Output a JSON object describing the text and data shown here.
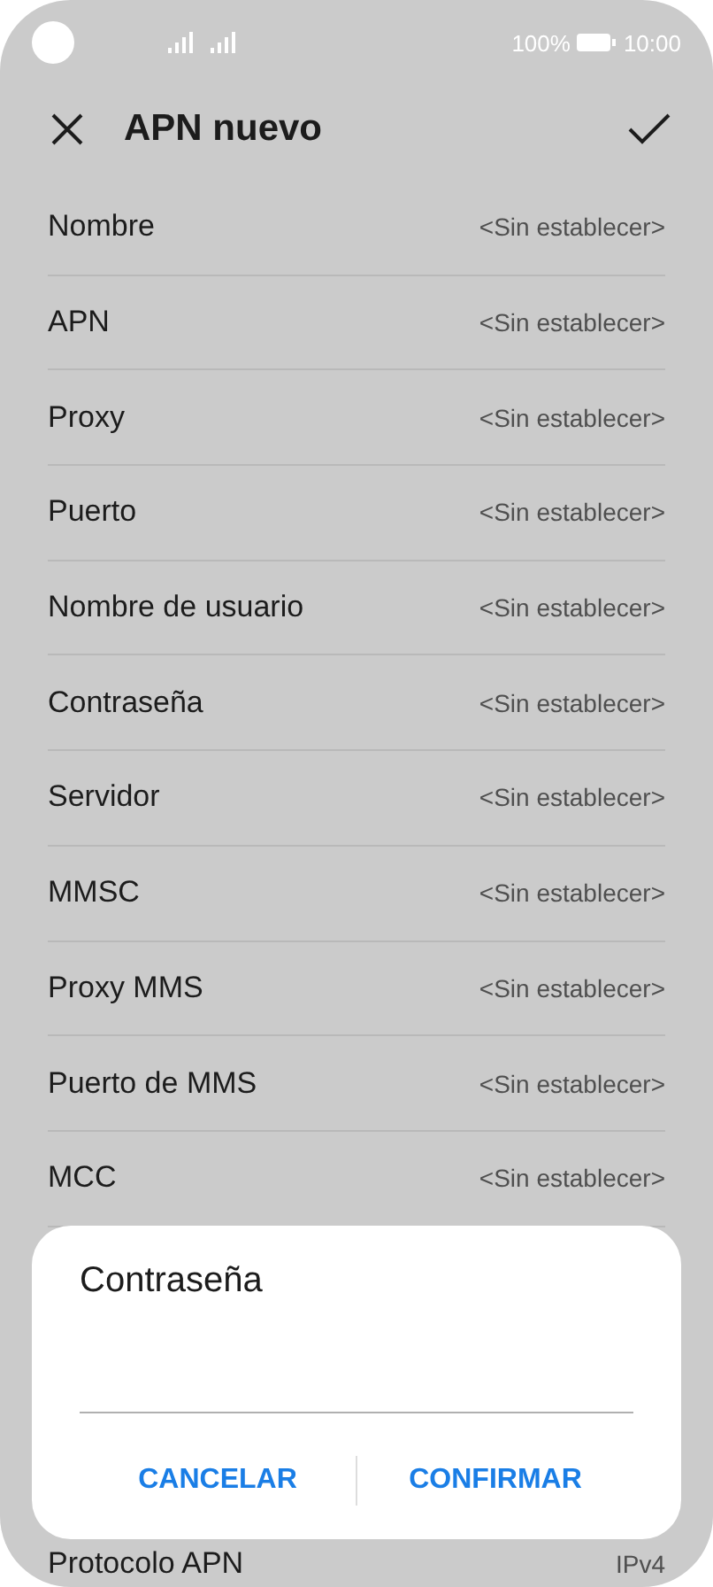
{
  "status_bar": {
    "battery": "100%",
    "time": "10:00"
  },
  "header": {
    "title": "APN nuevo"
  },
  "settings": [
    {
      "label": "Nombre",
      "value": "<Sin establecer>"
    },
    {
      "label": "APN",
      "value": "<Sin establecer>"
    },
    {
      "label": "Proxy",
      "value": "<Sin establecer>"
    },
    {
      "label": "Puerto",
      "value": "<Sin establecer>"
    },
    {
      "label": "Nombre de usuario",
      "value": "<Sin establecer>"
    },
    {
      "label": "Contraseña",
      "value": "<Sin establecer>"
    },
    {
      "label": "Servidor",
      "value": "<Sin establecer>"
    },
    {
      "label": "MMSC",
      "value": "<Sin establecer>"
    },
    {
      "label": "Proxy MMS",
      "value": "<Sin establecer>"
    },
    {
      "label": "Puerto de MMS",
      "value": "<Sin establecer>"
    },
    {
      "label": "MCC",
      "value": "<Sin establecer>"
    }
  ],
  "settings_below_dialog": [
    {
      "label": "Protocolo APN",
      "value": "IPv4"
    }
  ],
  "dialog": {
    "title": "Contraseña",
    "buttons": [
      "CANCELAR",
      "CONFIRMAR"
    ]
  }
}
